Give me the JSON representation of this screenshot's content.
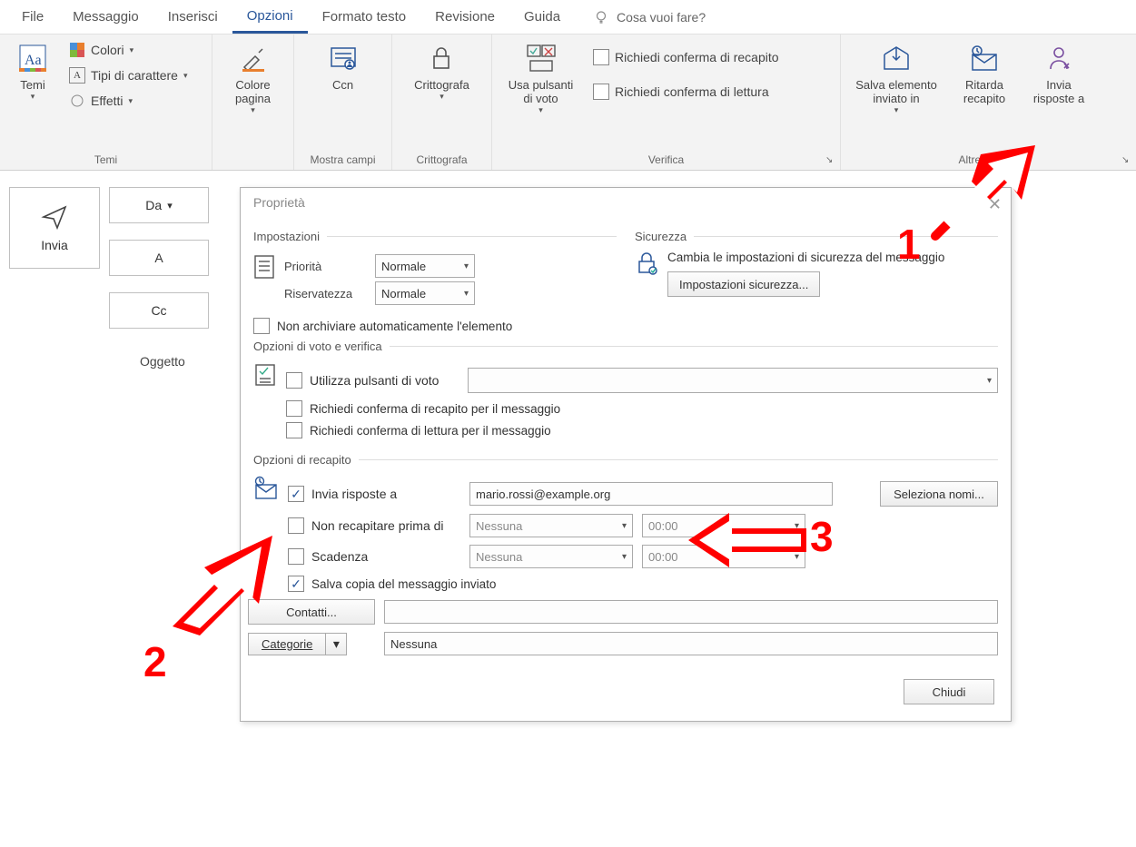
{
  "ribbon": {
    "tabs": [
      "File",
      "Messaggio",
      "Inserisci",
      "Opzioni",
      "Formato testo",
      "Revisione",
      "Guida"
    ],
    "active_tab_index": 3,
    "tell_me_placeholder": "Cosa vuoi fare?",
    "groups": {
      "temi": {
        "label": "Temi",
        "temi": "Temi",
        "colori": "Colori",
        "tipi": "Tipi di carattere",
        "effetti": "Effetti"
      },
      "colore_pagina": {
        "label": "Colore pagina"
      },
      "mostra_campi": {
        "label": "Mostra campi",
        "ccn": "Ccn"
      },
      "crittografa": {
        "label": "Crittografa",
        "btn": "Crittografa"
      },
      "verifica": {
        "label": "Verifica",
        "voto": "Usa pulsanti di voto",
        "conferma_recapito": "Richiedi conferma di recapito",
        "conferma_lettura": "Richiedi conferma di lettura"
      },
      "altre": {
        "label": "Altre opzioni",
        "salva": "Salva elemento inviato in",
        "ritarda": "Ritarda recapito",
        "risposte": "Invia risposte a"
      }
    }
  },
  "compose": {
    "send": "Invia",
    "da": "Da",
    "a": "A",
    "cc": "Cc",
    "oggetto_label": "Oggetto"
  },
  "dialog": {
    "title": "Proprietà",
    "sections": {
      "impostazioni": "Impostazioni",
      "sicurezza": "Sicurezza",
      "voto_verifica": "Opzioni di voto e verifica",
      "recapito": "Opzioni di recapito"
    },
    "priorita_label": "Priorità",
    "priorita_value": "Normale",
    "riservatezza_label": "Riservatezza",
    "riservatezza_value": "Normale",
    "non_archiviare": "Non archiviare automaticamente l'elemento",
    "sicurezza_text": "Cambia le impostazioni di sicurezza del messaggio",
    "sicurezza_btn": "Impostazioni sicurezza...",
    "voto_chk": "Utilizza pulsanti di voto",
    "conferma_recapito_msg": "Richiedi conferma di recapito per il messaggio",
    "conferma_lettura_msg": "Richiedi conferma di lettura per il messaggio",
    "invia_risposte_a": "Invia risposte a",
    "invia_risposte_value": "mario.rossi@example.org",
    "seleziona_nomi": "Seleziona nomi...",
    "non_recapitare": "Non recapitare prima di",
    "scadenza": "Scadenza",
    "nessuna": "Nessuna",
    "time_zero": "00:00",
    "salva_copia": "Salva copia del messaggio inviato",
    "contatti": "Contatti...",
    "categorie": "Categorie",
    "categorie_value": "Nessuna",
    "chiudi": "Chiudi"
  },
  "annotations": {
    "n1": "1",
    "n2": "2",
    "n3": "3"
  }
}
